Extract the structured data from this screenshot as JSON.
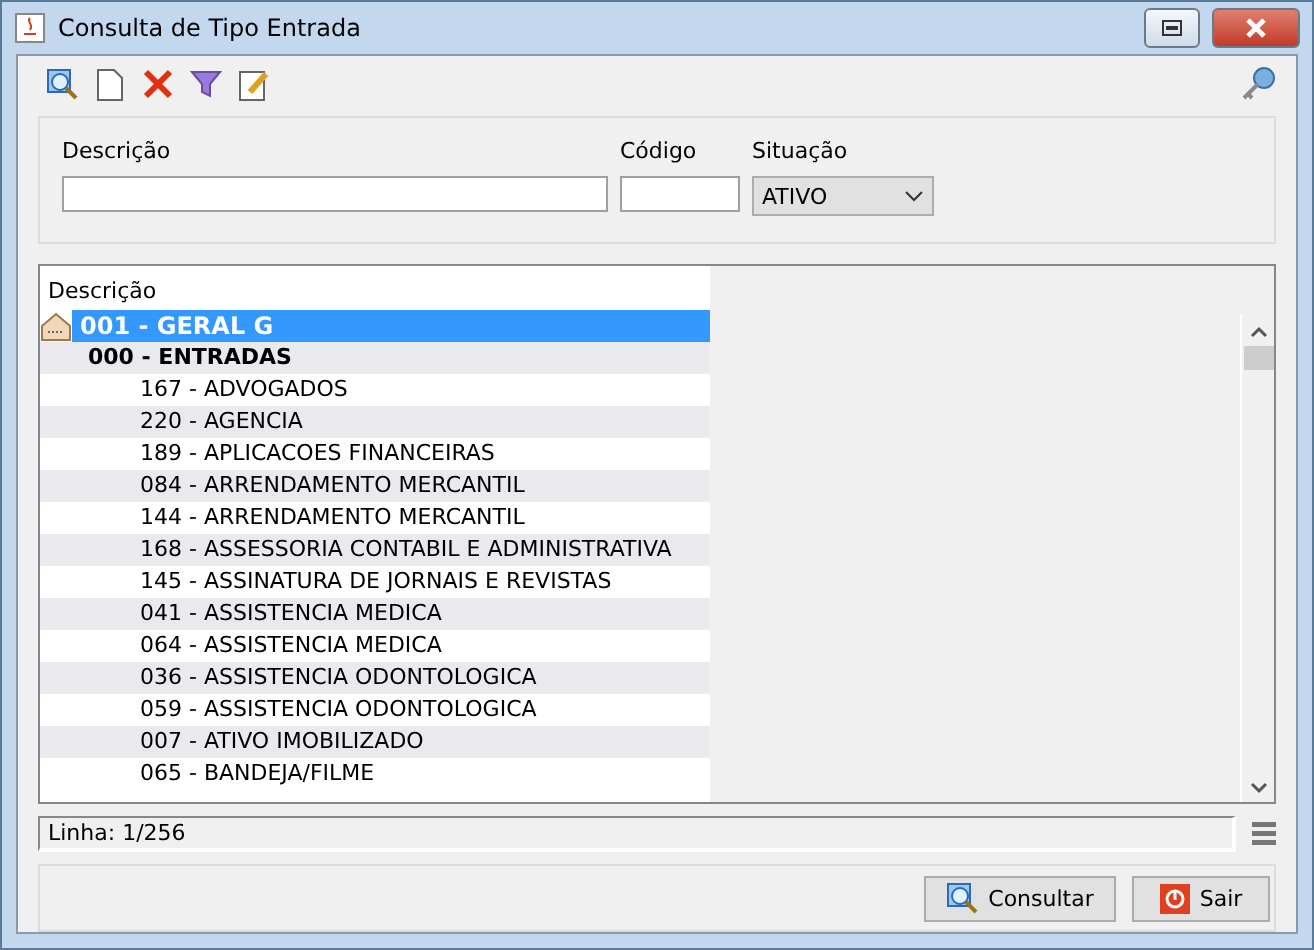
{
  "window": {
    "title": "Consulta de Tipo Entrada"
  },
  "filters": {
    "descricao": {
      "label": "Descrição"
    },
    "codigo": {
      "label": "Código"
    },
    "situacao": {
      "label": "Situação",
      "value": "ATIVO"
    }
  },
  "tree": {
    "column": "Descrição",
    "items": [
      {
        "label": "001 - GERAL G",
        "selected": true,
        "children": [
          {
            "label": "000 - ENTRADAS",
            "selected": false,
            "children": [
              {
                "label": "167 - ADVOGADOS",
                "selected": false
              },
              {
                "label": "220 - AGENCIA",
                "selected": false
              },
              {
                "label": "189 - APLICACOES FINANCEIRAS",
                "selected": false
              },
              {
                "label": "084 - ARRENDAMENTO MERCANTIL",
                "selected": false
              },
              {
                "label": "144 - ARRENDAMENTO MERCANTIL",
                "selected": false
              },
              {
                "label": "168 - ASSESSORIA CONTABIL E ADMINISTRATIVA",
                "selected": false
              },
              {
                "label": "145 - ASSINATURA DE JORNAIS E REVISTAS",
                "selected": false
              },
              {
                "label": "041 - ASSISTENCIA MEDICA",
                "selected": false
              },
              {
                "label": "064 - ASSISTENCIA MEDICA",
                "selected": false
              },
              {
                "label": "036 - ASSISTENCIA ODONTOLOGICA",
                "selected": false
              },
              {
                "label": "059 - ASSISTENCIA ODONTOLOGICA",
                "selected": false
              },
              {
                "label": "007 - ATIVO IMOBILIZADO",
                "selected": false
              },
              {
                "label": "065 - BANDEJA/FILME",
                "selected": false
              }
            ]
          }
        ]
      }
    ]
  },
  "status": "Linha: 1/256",
  "buttons": [
    {
      "kind": "search",
      "label": "Consultar"
    },
    {
      "kind": "exit",
      "label": "Sair"
    }
  ]
}
